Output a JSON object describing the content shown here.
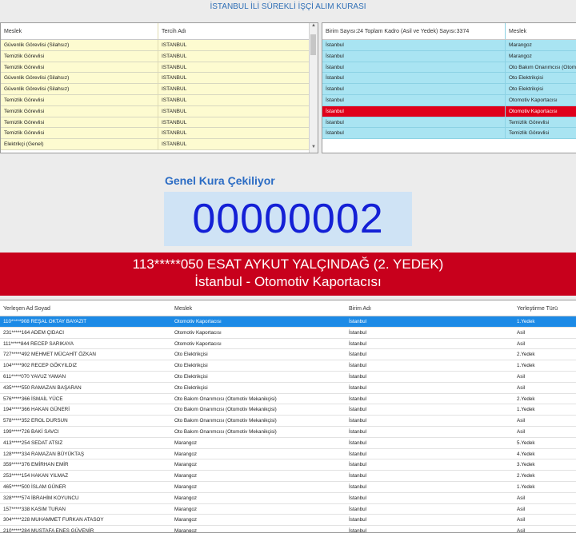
{
  "title": "İSTANBUL İLİ SÜREKLİ İŞÇİ ALIM KURASI",
  "left_grid": {
    "headers": [
      "Meslek",
      "Tercih Adı"
    ],
    "rows": [
      [
        "Güvenlik Görevlisi (Silahsız)",
        "ISTANBUL"
      ],
      [
        "Temizlik Görevlisi",
        "ISTANBUL"
      ],
      [
        "Temizlik Görevlisi",
        "ISTANBUL"
      ],
      [
        "Güvenlik Görevlisi (Silahsız)",
        "ISTANBUL"
      ],
      [
        "Güvenlik Görevlisi (Silahsız)",
        "ISTANBUL"
      ],
      [
        "Temizlik Görevlisi",
        "ISTANBUL"
      ],
      [
        "Temizlik Görevlisi",
        "ISTANBUL"
      ],
      [
        "Temizlik Görevlisi",
        "ISTANBUL"
      ],
      [
        "Temizlik Görevlisi",
        "ISTANBUL"
      ],
      [
        "Elektrikçi (Genel)",
        "ISTANBUL"
      ]
    ]
  },
  "right_grid": {
    "headers": [
      "Birim Sayısı:24 Toplam Kadro (Asil ve Yedek) Sayısı:3374",
      "Meslek"
    ],
    "rows": [
      [
        "İstanbul",
        "Marangoz"
      ],
      [
        "İstanbul",
        "Marangoz"
      ],
      [
        "İstanbul",
        "Oto Bakım Onarımcısı (Otomotiv"
      ],
      [
        "İstanbul",
        "Oto Elektrikçisi"
      ],
      [
        "İstanbul",
        "Oto Elektrikçisi"
      ],
      [
        "İstanbul",
        "Otomotiv Kaportacısı"
      ],
      [
        "İstanbul",
        "Otomotiv Kaportacısı"
      ],
      [
        "İstanbul",
        "Temizlik Görevlisi"
      ],
      [
        "İstanbul",
        "Temizlik Görevlisi"
      ]
    ],
    "selected_index": 6
  },
  "draw": {
    "label": "Genel Kura Çekiliyor",
    "number": "00000002"
  },
  "banner": {
    "line1": "113*****050 ESAT AYKUT YALÇINDAĞ (2. YEDEK)",
    "line2": "İstanbul - Otomotiv Kaportacısı"
  },
  "bottom_grid": {
    "headers": [
      "Yerleşen Ad Soyad",
      "Meslek",
      "Birim Adı",
      "Yerleştirme Türü"
    ],
    "rows": [
      [
        "110*****908 REŞAL OKTAY BAYAZIT",
        "Otomotiv Kaportacısı",
        "İstanbul",
        "1.Yedek"
      ],
      [
        "231*****164 ADEM ÇIDACI",
        "Otomotiv Kaportacısı",
        "İstanbul",
        "Asil"
      ],
      [
        "111*****844 RECEP SARIKAYA",
        "Otomotiv Kaportacısı",
        "İstanbul",
        "Asil"
      ],
      [
        "727*****492 MEHMET MÜCAHİT ÖZKAN",
        "Oto Elektrikçisi",
        "İstanbul",
        "2.Yedek"
      ],
      [
        "104*****902 RECEP GÖKYILDIZ",
        "Oto Elektrikçisi",
        "İstanbul",
        "1.Yedek"
      ],
      [
        "611*****070 YAVUZ YAMAN",
        "Oto Elektrikçisi",
        "İstanbul",
        "Asil"
      ],
      [
        "435*****550 RAMAZAN BAŞARAN",
        "Oto Elektrikçisi",
        "İstanbul",
        "Asil"
      ],
      [
        "576*****366 İSMAİL YÜCE",
        "Oto Bakım Onarımcısı (Otomotiv Mekanikçisi)",
        "İstanbul",
        "2.Yedek"
      ],
      [
        "194*****366 HAKAN GÜNERİ",
        "Oto Bakım Onarımcısı (Otomotiv Mekanikçisi)",
        "İstanbul",
        "1.Yedek"
      ],
      [
        "578*****352 EROL DURSUN",
        "Oto Bakım Onarımcısı (Otomotiv Mekanikçisi)",
        "İstanbul",
        "Asil"
      ],
      [
        "199*****726 BAKİ SAVCI",
        "Oto Bakım Onarımcısı (Otomotiv Mekanikçisi)",
        "İstanbul",
        "Asil"
      ],
      [
        "413*****254 SEDAT ATSIZ",
        "Marangoz",
        "İstanbul",
        "5.Yedek"
      ],
      [
        "128*****334 RAMAZAN BÜYÜKTAŞ",
        "Marangoz",
        "İstanbul",
        "4.Yedek"
      ],
      [
        "359*****376 EMİRHAN EMİR",
        "Marangoz",
        "İstanbul",
        "3.Yedek"
      ],
      [
        "253*****154 HAKAN YILMAZ",
        "Marangoz",
        "İstanbul",
        "2.Yedek"
      ],
      [
        "465*****500 İSLAM GÜNER",
        "Marangoz",
        "İstanbul",
        "1.Yedek"
      ],
      [
        "328*****574 İBRAHİM KOYUNCU",
        "Marangoz",
        "İstanbul",
        "Asil"
      ],
      [
        "157*****338 KASIM TURAN",
        "Marangoz",
        "İstanbul",
        "Asil"
      ],
      [
        "304*****228 MUHAMMET FURKAN ATASOY",
        "Marangoz",
        "İstanbul",
        "Asil"
      ],
      [
        "210*****284 MUSTAFA ENES GÜVENİR",
        "Marangoz",
        "İstanbul",
        "Asil"
      ]
    ],
    "selected_index": 0
  },
  "colors": {
    "accent": "#2b6cc4",
    "banner": "#c8001c",
    "counter": "#1420d6",
    "left_rows": "#fdfbd0",
    "right_rows": "#a9e4f2",
    "selection": "#1c8ae6"
  }
}
